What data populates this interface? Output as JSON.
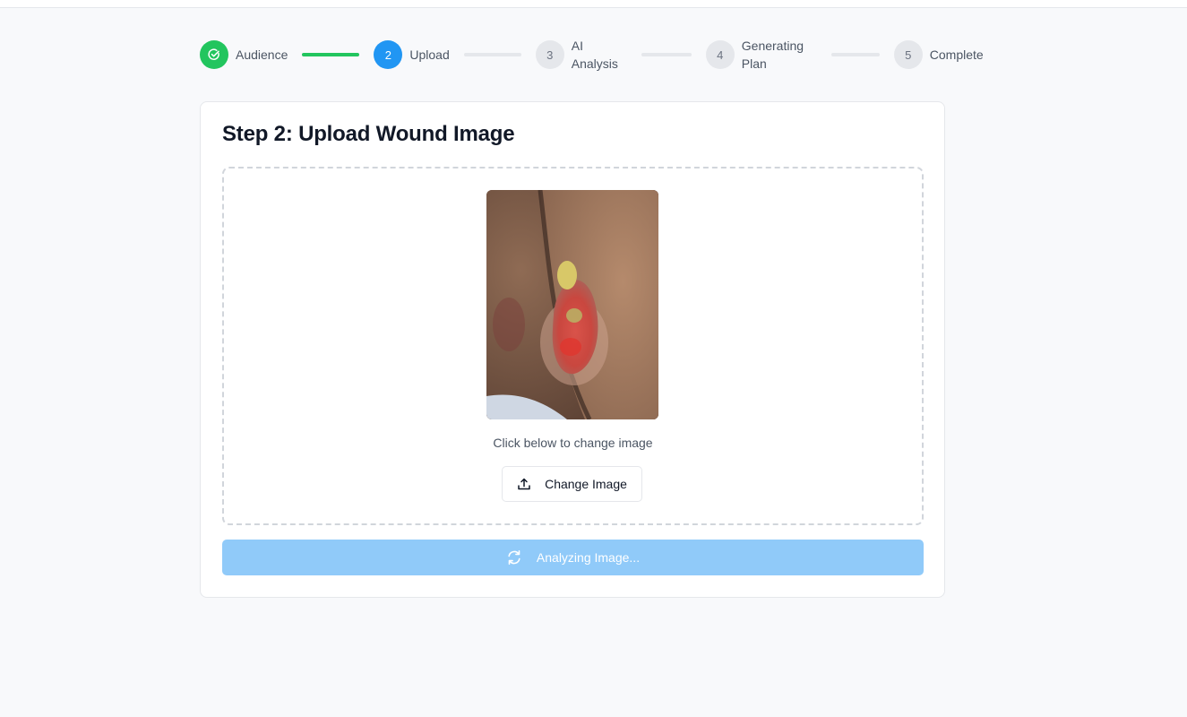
{
  "stepper": {
    "steps": [
      {
        "number": "",
        "label": "Audience",
        "state": "complete"
      },
      {
        "number": "2",
        "label": "Upload",
        "state": "active"
      },
      {
        "number": "3",
        "label": "AI Analysis",
        "state": "pending"
      },
      {
        "number": "4",
        "label": "Generating Plan",
        "state": "pending"
      },
      {
        "number": "5",
        "label": "Complete",
        "state": "pending"
      }
    ]
  },
  "card": {
    "title": "Step 2: Upload Wound Image",
    "hint": "Click below to change image",
    "change_button_label": "Change Image",
    "analyze_button_label": "Analyzing Image..."
  },
  "colors": {
    "complete": "#22c55e",
    "active": "#2196f3",
    "analyze_disabled": "#90caf9"
  },
  "icons": {
    "step1": "check-circle-icon",
    "change": "upload-icon",
    "analyze": "refresh-spinner-icon"
  }
}
